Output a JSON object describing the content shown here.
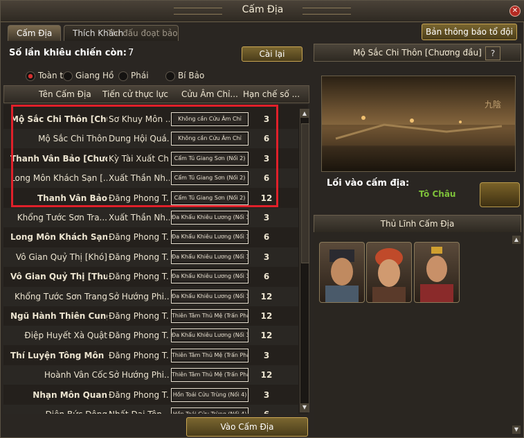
{
  "window": {
    "title": "Cấm Địa",
    "close_icon": "close-icon"
  },
  "tabs": [
    {
      "label": "Cấm Địa",
      "active": true
    },
    {
      "label": "Thích Khách",
      "active": false,
      "ghost_text": "Thi đấu đoạt bảo"
    }
  ],
  "team_notice_button": "Bản thông báo tổ đội",
  "challenge": {
    "label": "Số lần khiêu chiến còn:",
    "value": "7",
    "reset_button": "Cài lại"
  },
  "filters": [
    {
      "label": "Toàn t",
      "selected": true
    },
    {
      "label": "Giang Hồ",
      "selected": false
    },
    {
      "label": "Phái",
      "selected": false
    },
    {
      "label": "Bí Bảo",
      "selected": false
    }
  ],
  "table": {
    "headers": [
      "Tên Cấm Địa",
      "Tiến cử thực lực",
      "Cửu Âm Chỉ...",
      "Hạn chế số ..."
    ],
    "rows": [
      {
        "name": "Mộ Sắc Chi Thôn [Chư...",
        "power": "Sơ Khuy Môn ...",
        "req": "Không cần Cửu Âm Chỉ",
        "limit": "3",
        "bold": true
      },
      {
        "name": "Mộ Sắc Chi Thôn",
        "power": "Dung Hội Quá...",
        "req": "Không cần Cửu Âm Chỉ",
        "limit": "6",
        "bold": false
      },
      {
        "name": "Thanh Vân Bảo [Chươ...",
        "power": "Kỳ Tài Xuất Ch...",
        "req": "Cẩm Tú Giang Sơn (Nối 2)",
        "limit": "3",
        "bold": true
      },
      {
        "name": "Long Môn Khách Sạn [...",
        "power": "Xuất Thần Nh...",
        "req": "Cẩm Tú Giang Sơn (Nối 2)",
        "limit": "6",
        "bold": false
      },
      {
        "name": "Thanh Vân Bảo",
        "power": "Đăng Phong T...",
        "req": "Cẩm Tú Giang Sơn (Nối 2)",
        "limit": "12",
        "bold": true
      },
      {
        "name": "Khổng Tước Sơn Tra...",
        "power": "Xuất Thần Nh...",
        "req": "Đa Khẩu Khiêu Lương (Nối 3)",
        "limit": "3",
        "bold": false
      },
      {
        "name": "Long Môn Khách Sạn",
        "power": "Đăng Phong T...",
        "req": "Đa Khẩu Khiêu Lương (Nối 3)",
        "limit": "6",
        "bold": true
      },
      {
        "name": "Vô Gian Quỷ Thị [Khó]",
        "power": "Đăng Phong T...",
        "req": "Đa Khẩu Khiêu Lương (Nối 3)",
        "limit": "3",
        "bold": false
      },
      {
        "name": "Vô Gian Quỷ Thị [Thư...",
        "power": "Đăng Phong T...",
        "req": "Đa Khẩu Khiêu Lương (Nối 3)",
        "limit": "6",
        "bold": true
      },
      {
        "name": "Khổng Tước Sơn Trang",
        "power": "Sở Hướng Phi...",
        "req": "Đa Khẩu Khiêu Lương (Nối 3)",
        "limit": "12",
        "bold": false
      },
      {
        "name": "Ngũ Hành Thiên Cung",
        "power": "Đăng Phong T...",
        "req": "Thiên Tâm Thủ Mệ (Trấn Phái)",
        "limit": "12",
        "bold": true
      },
      {
        "name": "Điệp Huyết Xà Quật",
        "power": "Đăng Phong T...",
        "req": "Đa Khẩu Khiêu Lương (Nối 3)",
        "limit": "12",
        "bold": false
      },
      {
        "name": "Thí Luyện Tông Môn [T...",
        "power": "Đăng Phong T...",
        "req": "Thiên Tâm Thủ Mệ (Trấn Phái)",
        "limit": "3",
        "bold": true
      },
      {
        "name": "Hoành Vân Cốc",
        "power": "Sở Hướng Phi...",
        "req": "Thiên Tâm Thủ Mệ (Trấn Phái)",
        "limit": "12",
        "bold": false
      },
      {
        "name": "Nhạn Môn Quan",
        "power": "Đăng Phong T...",
        "req": "Hồn Toái Cửu Trùng (Nối 4)",
        "limit": "3",
        "bold": true
      },
      {
        "name": "Điện Bức Động",
        "power": "Nhất Đại Tôn...",
        "req": "Hồn Toái Cửu Trùng (Nối 4)",
        "limit": "6",
        "bold": false
      }
    ]
  },
  "enter_button": "Vào Cấm Địa",
  "detail": {
    "title": "Mộ Sắc Chi Thôn [Chương đầu]",
    "help_icon": "question-icon",
    "entry_label": "Lối vào cấm địa:",
    "entry_value": "Tô Châu"
  },
  "leaders": {
    "title": "Thủ Lĩnh Cấm Địa",
    "portraits": [
      "leader-1",
      "leader-2",
      "leader-3"
    ]
  }
}
